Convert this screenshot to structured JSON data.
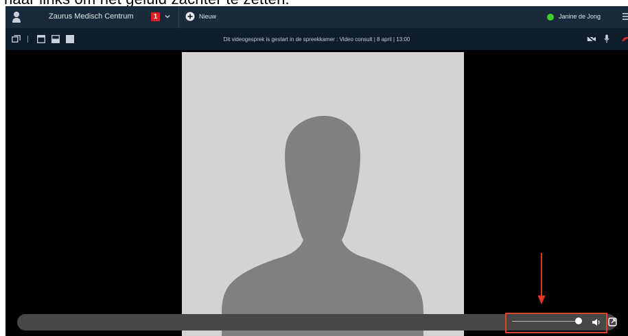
{
  "caption": "naar links om het geluid zachter te zetten.",
  "topbar": {
    "logo_icon": "person-icon",
    "clinic_name": "Zaurus Medisch Centrum",
    "notification_count": "1",
    "new_label": "Nieuw",
    "user_name": "Janine de Jong",
    "status_color": "#3ccf2d"
  },
  "call": {
    "notice": "Dit videogesprek is gestart in de spreekkamer : Video consult | 8 april | 13:00"
  },
  "volume": {
    "level": 0.95
  },
  "colors": {
    "highlight": "#d9452f",
    "topbar": "#1a2a3c"
  }
}
